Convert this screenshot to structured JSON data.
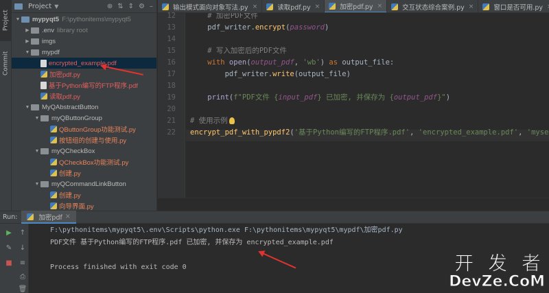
{
  "tool_strip": {
    "project": "Project",
    "commit": "Commit"
  },
  "project_panel": {
    "title": "Project",
    "tree": [
      {
        "label": "mypyqt5",
        "extra": "F:\\pythonitems\\mypyqt5",
        "kind": "folder",
        "depth": 0,
        "expanded": true
      },
      {
        "label": ".env",
        "extra": "library root",
        "kind": "folder",
        "depth": 1,
        "expanded": false
      },
      {
        "label": "imgs",
        "extra": "",
        "kind": "folder",
        "depth": 1,
        "expanded": false
      },
      {
        "label": "mypdf",
        "extra": "",
        "kind": "folder",
        "depth": 1,
        "expanded": true
      },
      {
        "label": "encrypted_example.pdf",
        "extra": "",
        "kind": "pdf",
        "depth": 2,
        "selected": true
      },
      {
        "label": "加密pdf.py",
        "extra": "",
        "kind": "py",
        "depth": 2
      },
      {
        "label": "基于Python编写的FTP程序.pdf",
        "extra": "",
        "kind": "pdf",
        "depth": 2
      },
      {
        "label": "读取pdf.py",
        "extra": "",
        "kind": "py",
        "depth": 2
      },
      {
        "label": "MyQAbstractButton",
        "extra": "",
        "kind": "folder",
        "depth": 1,
        "expanded": true
      },
      {
        "label": "myQButtonGroup",
        "extra": "",
        "kind": "folder",
        "depth": 2,
        "expanded": true
      },
      {
        "label": "QButtonGroup功能测试.py",
        "extra": "",
        "kind": "py",
        "depth": 3
      },
      {
        "label": "按钮组的创建与使用.py",
        "extra": "",
        "kind": "py",
        "depth": 3
      },
      {
        "label": "myQCheckBox",
        "extra": "",
        "kind": "folder",
        "depth": 2,
        "expanded": true
      },
      {
        "label": "QCheckBox功能测试.py",
        "extra": "",
        "kind": "py",
        "depth": 3
      },
      {
        "label": "创建.py",
        "extra": "",
        "kind": "py",
        "depth": 3
      },
      {
        "label": "myQCommandLinkButton",
        "extra": "",
        "kind": "folder",
        "depth": 2,
        "expanded": true
      },
      {
        "label": "创建.py",
        "extra": "",
        "kind": "py",
        "depth": 3
      },
      {
        "label": "向导界面.py",
        "extra": "",
        "kind": "py",
        "depth": 3
      }
    ]
  },
  "tabs": [
    {
      "label": "输出模式面向对象写法.py",
      "active": false
    },
    {
      "label": "读取pdf.py",
      "active": false
    },
    {
      "label": "加密pdf.py",
      "active": true
    },
    {
      "label": "交互状态综合案例.py",
      "active": false
    },
    {
      "label": "窗口是否可用.py",
      "active": false
    },
    {
      "label": "窗口",
      "active": false
    }
  ],
  "editor": {
    "lines": [
      {
        "num": "12",
        "text": "    # 加密PDF文件"
      },
      {
        "num": "13",
        "text": "    pdf_writer.encrypt(password)"
      },
      {
        "num": "14",
        "text": ""
      },
      {
        "num": "15",
        "text": "    # 写入加密后的PDF文件"
      },
      {
        "num": "16",
        "text": "    with open(output_pdf, 'wb') as output_file:"
      },
      {
        "num": "17",
        "text": "        pdf_writer.write(output_file)"
      },
      {
        "num": "18",
        "text": ""
      },
      {
        "num": "19",
        "text": "    print(f\"PDF文件 {input_pdf} 已加密, 并保存为 {output_pdf}\")"
      },
      {
        "num": "20",
        "text": ""
      },
      {
        "num": "21",
        "text": "# 使用示例"
      },
      {
        "num": "22",
        "text": "encrypt_pdf_with_pypdf2('基于Python编写的FTP程序.pdf', 'encrypted_example.pdf', 'myse"
      }
    ]
  },
  "run_panel": {
    "label": "Run:",
    "tab": "加密pdf",
    "console": [
      "F:\\pythonitems\\mypyqt5\\.env\\Scripts\\python.exe F:\\pythonitems\\mypyqt5\\mypdf\\加密pdf.py",
      "PDF文件 基于Python编写的FTP程序.pdf 已加密, 并保存为 encrypted_example.pdf",
      "",
      "Process finished with exit code 0"
    ]
  },
  "watermark": {
    "cn": "开 发 者",
    "en": "DevZe.CoM"
  },
  "colors": {
    "accent": "#4a88c7",
    "annotation": "#e0342f",
    "selection": "#0d293e"
  }
}
